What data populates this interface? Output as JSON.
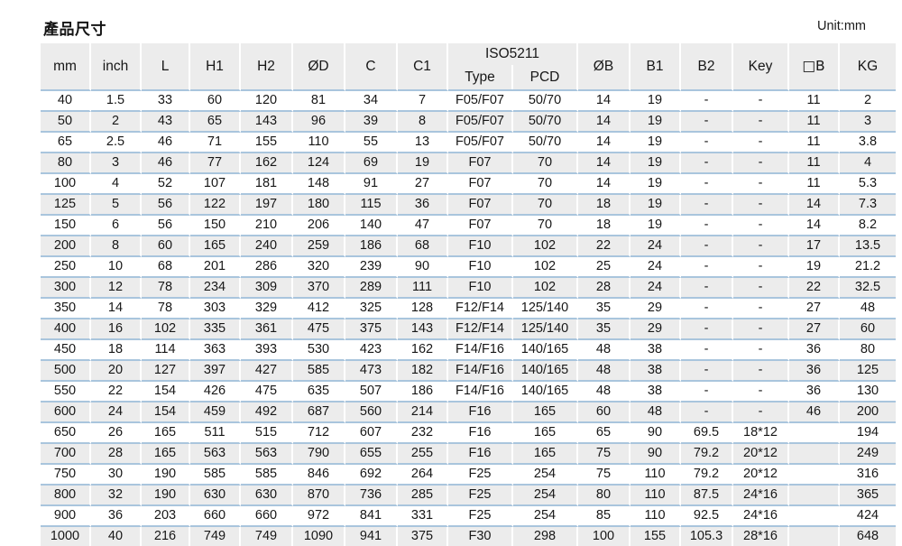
{
  "title": "產品尺寸",
  "unit_label": "Unit:mm",
  "table": {
    "columns": [
      {
        "key": "mm",
        "label": "mm"
      },
      {
        "key": "inch",
        "label": "inch"
      },
      {
        "key": "L",
        "label": "L"
      },
      {
        "key": "H1",
        "label": "H1"
      },
      {
        "key": "H2",
        "label": "H2"
      },
      {
        "key": "OD",
        "label": "ØD"
      },
      {
        "key": "C",
        "label": "C"
      },
      {
        "key": "C1",
        "label": "C1"
      },
      {
        "key": "OB",
        "label": "ØB"
      },
      {
        "key": "B1",
        "label": "B1"
      },
      {
        "key": "B2",
        "label": "B2"
      },
      {
        "key": "Key",
        "label": "Key"
      },
      {
        "key": "SQB",
        "label": "□B"
      },
      {
        "key": "KG",
        "label": "KG"
      }
    ],
    "group_header": {
      "label": "ISO5211",
      "sub": [
        {
          "key": "iso_type",
          "label": "Type"
        },
        {
          "key": "iso_pcd",
          "label": "PCD"
        }
      ]
    },
    "rows": [
      {
        "mm": "40",
        "inch": "1.5",
        "L": "33",
        "H1": "60",
        "H2": "120",
        "OD": "81",
        "C": "34",
        "C1": "7",
        "iso_type": "F05/F07",
        "iso_pcd": "50/70",
        "OB": "14",
        "B1": "19",
        "B2": "-",
        "Key": "-",
        "SQB": "11",
        "KG": "2"
      },
      {
        "mm": "50",
        "inch": "2",
        "L": "43",
        "H1": "65",
        "H2": "143",
        "OD": "96",
        "C": "39",
        "C1": "8",
        "iso_type": "F05/F07",
        "iso_pcd": "50/70",
        "OB": "14",
        "B1": "19",
        "B2": "-",
        "Key": "-",
        "SQB": "11",
        "KG": "3"
      },
      {
        "mm": "65",
        "inch": "2.5",
        "L": "46",
        "H1": "71",
        "H2": "155",
        "OD": "110",
        "C": "55",
        "C1": "13",
        "iso_type": "F05/F07",
        "iso_pcd": "50/70",
        "OB": "14",
        "B1": "19",
        "B2": "-",
        "Key": "-",
        "SQB": "11",
        "KG": "3.8"
      },
      {
        "mm": "80",
        "inch": "3",
        "L": "46",
        "H1": "77",
        "H2": "162",
        "OD": "124",
        "C": "69",
        "C1": "19",
        "iso_type": "F07",
        "iso_pcd": "70",
        "OB": "14",
        "B1": "19",
        "B2": "-",
        "Key": "-",
        "SQB": "11",
        "KG": "4"
      },
      {
        "mm": "100",
        "inch": "4",
        "L": "52",
        "H1": "107",
        "H2": "181",
        "OD": "148",
        "C": "91",
        "C1": "27",
        "iso_type": "F07",
        "iso_pcd": "70",
        "OB": "14",
        "B1": "19",
        "B2": "-",
        "Key": "-",
        "SQB": "11",
        "KG": "5.3"
      },
      {
        "mm": "125",
        "inch": "5",
        "L": "56",
        "H1": "122",
        "H2": "197",
        "OD": "180",
        "C": "115",
        "C1": "36",
        "iso_type": "F07",
        "iso_pcd": "70",
        "OB": "18",
        "B1": "19",
        "B2": "-",
        "Key": "-",
        "SQB": "14",
        "KG": "7.3"
      },
      {
        "mm": "150",
        "inch": "6",
        "L": "56",
        "H1": "150",
        "H2": "210",
        "OD": "206",
        "C": "140",
        "C1": "47",
        "iso_type": "F07",
        "iso_pcd": "70",
        "OB": "18",
        "B1": "19",
        "B2": "-",
        "Key": "-",
        "SQB": "14",
        "KG": "8.2"
      },
      {
        "mm": "200",
        "inch": "8",
        "L": "60",
        "H1": "165",
        "H2": "240",
        "OD": "259",
        "C": "186",
        "C1": "68",
        "iso_type": "F10",
        "iso_pcd": "102",
        "OB": "22",
        "B1": "24",
        "B2": "-",
        "Key": "-",
        "SQB": "17",
        "KG": "13.5"
      },
      {
        "mm": "250",
        "inch": "10",
        "L": "68",
        "H1": "201",
        "H2": "286",
        "OD": "320",
        "C": "239",
        "C1": "90",
        "iso_type": "F10",
        "iso_pcd": "102",
        "OB": "25",
        "B1": "24",
        "B2": "-",
        "Key": "-",
        "SQB": "19",
        "KG": "21.2"
      },
      {
        "mm": "300",
        "inch": "12",
        "L": "78",
        "H1": "234",
        "H2": "309",
        "OD": "370",
        "C": "289",
        "C1": "111",
        "iso_type": "F10",
        "iso_pcd": "102",
        "OB": "28",
        "B1": "24",
        "B2": "-",
        "Key": "-",
        "SQB": "22",
        "KG": "32.5"
      },
      {
        "mm": "350",
        "inch": "14",
        "L": "78",
        "H1": "303",
        "H2": "329",
        "OD": "412",
        "C": "325",
        "C1": "128",
        "iso_type": "F12/F14",
        "iso_pcd": "125/140",
        "OB": "35",
        "B1": "29",
        "B2": "-",
        "Key": "-",
        "SQB": "27",
        "KG": "48"
      },
      {
        "mm": "400",
        "inch": "16",
        "L": "102",
        "H1": "335",
        "H2": "361",
        "OD": "475",
        "C": "375",
        "C1": "143",
        "iso_type": "F12/F14",
        "iso_pcd": "125/140",
        "OB": "35",
        "B1": "29",
        "B2": "-",
        "Key": "-",
        "SQB": "27",
        "KG": "60"
      },
      {
        "mm": "450",
        "inch": "18",
        "L": "114",
        "H1": "363",
        "H2": "393",
        "OD": "530",
        "C": "423",
        "C1": "162",
        "iso_type": "F14/F16",
        "iso_pcd": "140/165",
        "OB": "48",
        "B1": "38",
        "B2": "-",
        "Key": "-",
        "SQB": "36",
        "KG": "80"
      },
      {
        "mm": "500",
        "inch": "20",
        "L": "127",
        "H1": "397",
        "H2": "427",
        "OD": "585",
        "C": "473",
        "C1": "182",
        "iso_type": "F14/F16",
        "iso_pcd": "140/165",
        "OB": "48",
        "B1": "38",
        "B2": "-",
        "Key": "-",
        "SQB": "36",
        "KG": "125"
      },
      {
        "mm": "550",
        "inch": "22",
        "L": "154",
        "H1": "426",
        "H2": "475",
        "OD": "635",
        "C": "507",
        "C1": "186",
        "iso_type": "F14/F16",
        "iso_pcd": "140/165",
        "OB": "48",
        "B1": "38",
        "B2": "-",
        "Key": "-",
        "SQB": "36",
        "KG": "130"
      },
      {
        "mm": "600",
        "inch": "24",
        "L": "154",
        "H1": "459",
        "H2": "492",
        "OD": "687",
        "C": "560",
        "C1": "214",
        "iso_type": "F16",
        "iso_pcd": "165",
        "OB": "60",
        "B1": "48",
        "B2": "-",
        "Key": "-",
        "SQB": "46",
        "KG": "200"
      },
      {
        "mm": "650",
        "inch": "26",
        "L": "165",
        "H1": "511",
        "H2": "515",
        "OD": "712",
        "C": "607",
        "C1": "232",
        "iso_type": "F16",
        "iso_pcd": "165",
        "OB": "65",
        "B1": "90",
        "B2": "69.5",
        "Key": "18*12",
        "SQB": "",
        "KG": "194"
      },
      {
        "mm": "700",
        "inch": "28",
        "L": "165",
        "H1": "563",
        "H2": "563",
        "OD": "790",
        "C": "655",
        "C1": "255",
        "iso_type": "F16",
        "iso_pcd": "165",
        "OB": "75",
        "B1": "90",
        "B2": "79.2",
        "Key": "20*12",
        "SQB": "",
        "KG": "249"
      },
      {
        "mm": "750",
        "inch": "30",
        "L": "190",
        "H1": "585",
        "H2": "585",
        "OD": "846",
        "C": "692",
        "C1": "264",
        "iso_type": "F25",
        "iso_pcd": "254",
        "OB": "75",
        "B1": "110",
        "B2": "79.2",
        "Key": "20*12",
        "SQB": "",
        "KG": "316"
      },
      {
        "mm": "800",
        "inch": "32",
        "L": "190",
        "H1": "630",
        "H2": "630",
        "OD": "870",
        "C": "736",
        "C1": "285",
        "iso_type": "F25",
        "iso_pcd": "254",
        "OB": "80",
        "B1": "110",
        "B2": "87.5",
        "Key": "24*16",
        "SQB": "",
        "KG": "365"
      },
      {
        "mm": "900",
        "inch": "36",
        "L": "203",
        "H1": "660",
        "H2": "660",
        "OD": "972",
        "C": "841",
        "C1": "331",
        "iso_type": "F25",
        "iso_pcd": "254",
        "OB": "85",
        "B1": "110",
        "B2": "92.5",
        "Key": "24*16",
        "SQB": "",
        "KG": "424"
      },
      {
        "mm": "1000",
        "inch": "40",
        "L": "216",
        "H1": "749",
        "H2": "749",
        "OD": "1090",
        "C": "941",
        "C1": "375",
        "iso_type": "F30",
        "iso_pcd": "298",
        "OB": "100",
        "B1": "155",
        "B2": "105.3",
        "Key": "28*16",
        "SQB": "",
        "KG": "648"
      }
    ]
  },
  "colors": {
    "header_bg": "#ececec",
    "row_alt_bg": "#ececec",
    "separator": "#a9c5dd",
    "text": "#171717"
  }
}
